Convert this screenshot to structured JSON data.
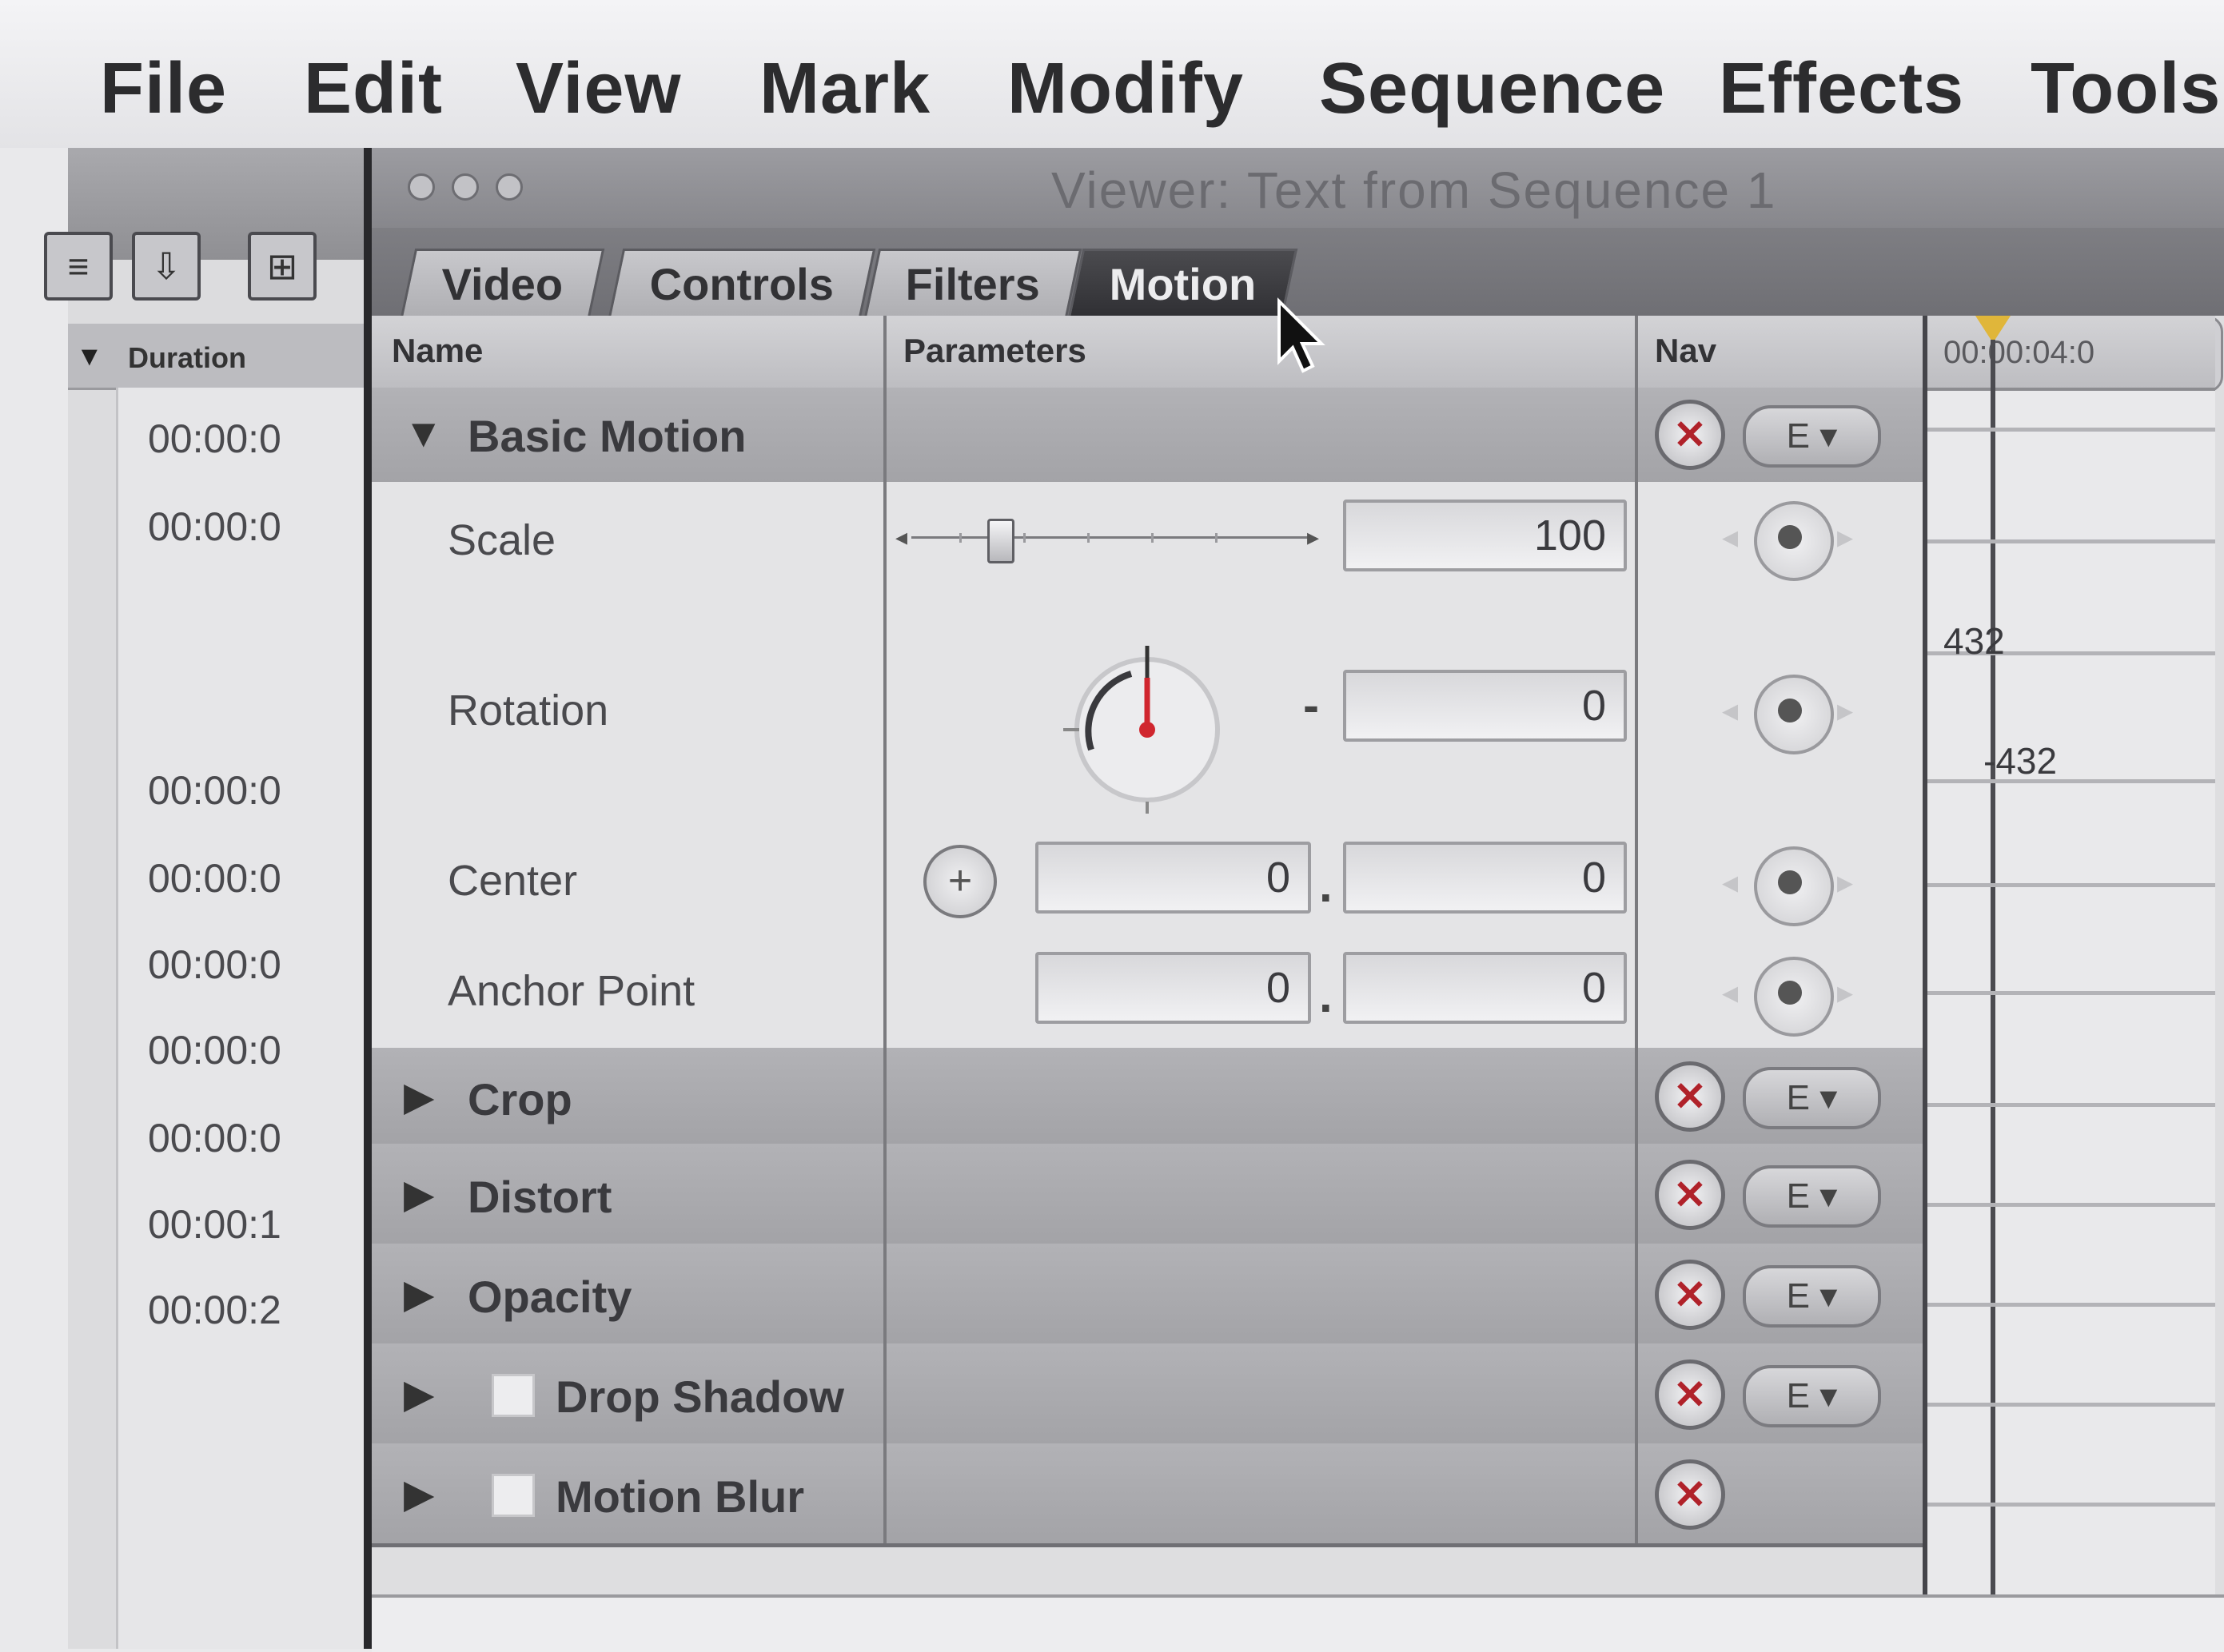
{
  "menubar": {
    "items": [
      "File",
      "Edit",
      "View",
      "Mark",
      "Modify",
      "Sequence",
      "Effects",
      "Tools"
    ]
  },
  "browser": {
    "column_header": "Duration",
    "durations": [
      "00:00:0",
      "00:00:0",
      "00:00:0",
      "00:00:0",
      "00:00:0",
      "00:00:0",
      "00:00:0",
      "00:00:1",
      "00:00:2"
    ]
  },
  "viewer": {
    "title": "Viewer: Text from Sequence 1",
    "tabs": [
      "Video",
      "Controls",
      "Filters",
      "Motion"
    ],
    "active_tab": "Motion",
    "columns": {
      "name": "Name",
      "parameters": "Parameters",
      "nav": "Nav"
    },
    "groups": {
      "basic_motion": "Basic Motion",
      "crop": "Crop",
      "distort": "Distort",
      "opacity": "Opacity",
      "drop_shadow": "Drop Shadow",
      "motion_blur": "Motion Blur"
    },
    "params": {
      "scale": {
        "label": "Scale",
        "value": "100"
      },
      "rotation": {
        "label": "Rotation",
        "value": "0"
      },
      "center": {
        "label": "Center",
        "x": "0",
        "y": "0"
      },
      "anchor_point": {
        "label": "Anchor Point",
        "x": "0",
        "y": "0"
      }
    },
    "reset_glyph": "✕",
    "preset_glyph": "E ▾",
    "kf_graph": {
      "timecode": "00:00:04:0",
      "rotation_max": "432",
      "rotation_min": "-432"
    }
  },
  "colors": {
    "accent_red": "#d0262e",
    "playhead_yellow": "#e0b63a"
  }
}
